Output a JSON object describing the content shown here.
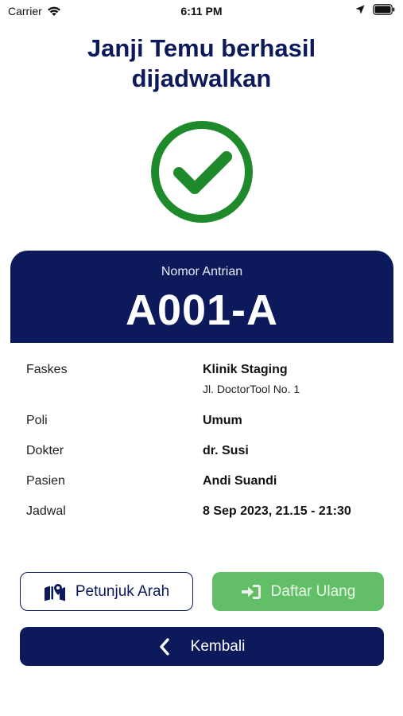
{
  "status_bar": {
    "carrier": "Carrier",
    "time": "6:11 PM",
    "icons": [
      "wifi-icon",
      "location-arrow-icon",
      "battery-icon"
    ]
  },
  "title": "Janji Temu berhasil dijadwalkan",
  "success_icon": "check-circle-icon",
  "queue": {
    "label": "Nomor Antrian",
    "number": "A001-A"
  },
  "details": {
    "faskes_label": "Faskes",
    "faskes_value": "Klinik Staging",
    "faskes_address": "Jl. DoctorTool No. 1",
    "poli_label": "Poli",
    "poli_value": "Umum",
    "dokter_label": "Dokter",
    "dokter_value": "dr. Susi",
    "pasien_label": "Pasien",
    "pasien_value": "Andi Suandi",
    "jadwal_label": "Jadwal",
    "jadwal_value": "8 Sep 2023, 21.15 - 21:30"
  },
  "buttons": {
    "directions_label": "Petunjuk Arah",
    "directions_icon": "map-marker-icon",
    "checkin_label": "Daftar Ulang",
    "checkin_icon": "sign-in-icon",
    "back_label": "Kembali",
    "back_icon": "chevron-left-icon"
  },
  "colors": {
    "primary_navy": "#0c1a5b",
    "success_green": "#1e8a2c",
    "checkin_green": "#63bf67"
  }
}
